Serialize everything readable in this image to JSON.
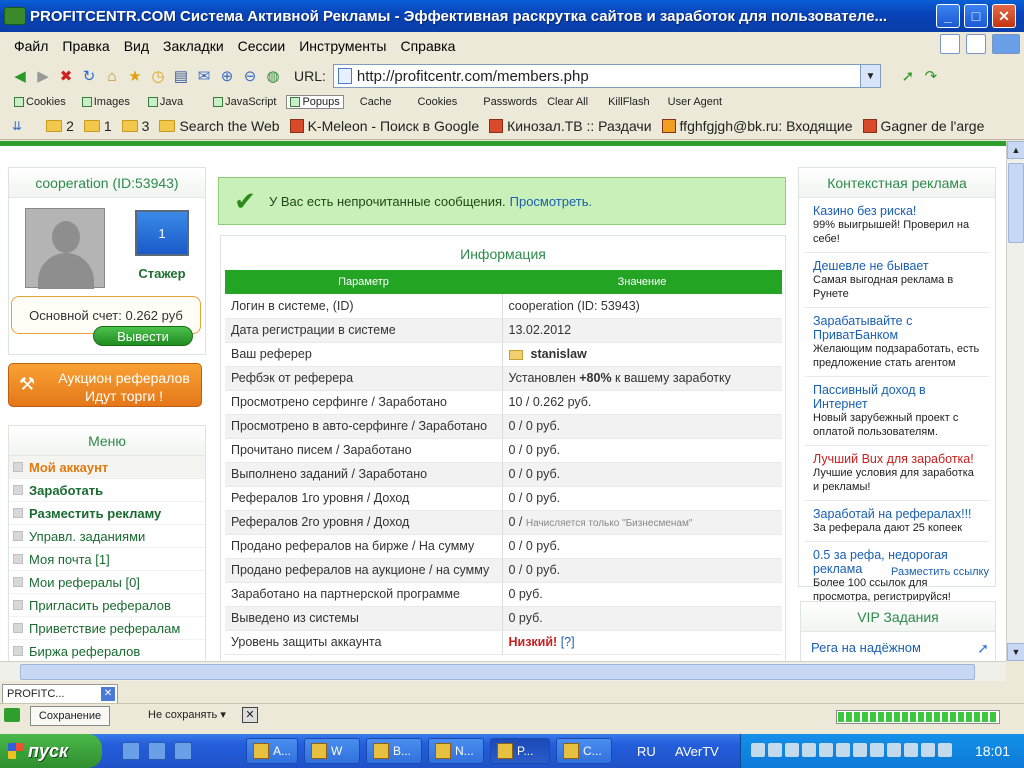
{
  "window": {
    "title": "PROFITCENTR.COM Система Активной Рекламы - Эффективная раскрутка сайтов и заработок для пользователе...",
    "min_symbol": "_",
    "max_symbol": "□",
    "close_symbol": "✕"
  },
  "menubar": [
    "Файл",
    "Правка",
    "Вид",
    "Закладки",
    "Сессии",
    "Инструменты",
    "Справка"
  ],
  "nav": {
    "url_label": "URL:",
    "url": "http://profitcentr.com/members.php"
  },
  "plugins": [
    "Cookies",
    "Images",
    "Java",
    "JavaScript",
    "Popups",
    "Cache",
    "Cookies",
    "Passwords",
    "Clear All",
    "KillFlash",
    "User Agent"
  ],
  "bookmarks": [
    "2",
    "1",
    "3",
    "Search the Web",
    "K-Meleon - Поиск в Google",
    "Кинозал.ТВ :: Раздачи",
    "ffghfgjgh@bk.ru: Входящие",
    "Gagner de l'arge"
  ],
  "user": {
    "name": "cooperation (ID:53943)",
    "level_number": "1",
    "rank": "Стажер",
    "balance": "Основной счет: 0.262 руб",
    "withdraw": "Вывести"
  },
  "auction": {
    "line1": "Аукцион рефералов",
    "line2": "Идут торги !"
  },
  "menu": {
    "title": "Меню",
    "items": [
      {
        "label": "Мой аккаунт",
        "style": "active"
      },
      {
        "label": "Заработать",
        "style": "bold"
      },
      {
        "label": "Разместить рекламу",
        "style": "bold"
      },
      {
        "label": "Управл. заданиями",
        "style": ""
      },
      {
        "label": "Моя почта   [1]",
        "style": ""
      },
      {
        "label": "Мои рефералы [0]",
        "style": ""
      },
      {
        "label": "Пригласить рефералов",
        "style": ""
      },
      {
        "label": "Приветствие рефералам",
        "style": ""
      },
      {
        "label": "Биржа рефералов",
        "style": ""
      }
    ]
  },
  "notice": {
    "text": "У Вас есть непрочитанные сообщения.",
    "link": "Просмотреть."
  },
  "info": {
    "title": "Информация",
    "columns": [
      "Параметр",
      "Значение"
    ],
    "rows": [
      {
        "param": "Логин в системе, (ID)",
        "value": "cooperation (ID: 53943)"
      },
      {
        "param": "Дата регистрации в системе",
        "value": "13.02.2012"
      },
      {
        "param": "Ваш реферер",
        "value": "stanislaw"
      },
      {
        "param": "Рефбэк от реферера",
        "value_pre": "Установлен",
        "value_strong": "+80%",
        "value_post": "к вашему заработку"
      },
      {
        "param": "Просмотрено серфинге / Заработано",
        "value": "10 / 0.262 руб."
      },
      {
        "param": "Просмотрено в авто-серфинге / Заработано",
        "value": "0 / 0 руб."
      },
      {
        "param": "Прочитано писем / Заработано",
        "value": "0 / 0 руб."
      },
      {
        "param": "Выполнено заданий / Заработано",
        "value": "0 / 0 руб."
      },
      {
        "param": "Рефералов 1го уровня / Доход",
        "value": "0 / 0 руб."
      },
      {
        "param": "Рефералов 2го уровня / Доход",
        "value": "0 /",
        "value_note": "Начисляется только \"Бизнесменам\""
      },
      {
        "param": "Продано рефералов на бирже / На сумму",
        "value": "0 / 0 руб."
      },
      {
        "param": "Продано рефералов на аукционе / на сумму",
        "value": "0 / 0 руб."
      },
      {
        "param": "Заработано на партнерской программе",
        "value": "0 руб."
      },
      {
        "param": "Выведено из системы",
        "value": "0 руб."
      },
      {
        "param": "Уровень защиты аккаунта",
        "value_warn": "Низкий!",
        "value_link": "[?]"
      }
    ]
  },
  "ads": {
    "title": "Контекстная реклама",
    "items": [
      {
        "title": "Казино без риска!",
        "desc": "99% выигрышей! Проверил на себе!",
        "red": false
      },
      {
        "title": "Дешевле не бывает",
        "desc": "Самая выгодная реклама в Рунете",
        "red": false
      },
      {
        "title": "Зарабатывайте с ПриватБанком",
        "desc": "Желающим подзаработать, есть предложение стать агентом",
        "red": false
      },
      {
        "title": "Пассивный доход в Интернет",
        "desc": "Новый зарубежный проект с оплатой пользователям.",
        "red": false
      },
      {
        "title": "Лучший Bux для заработка!",
        "desc": "Лучшие условия для заработка и рекламы!",
        "red": true
      },
      {
        "title": "Заработай на рефералах!!!",
        "desc": "За реферала дают 25 копеек",
        "red": false
      },
      {
        "title": "0.5 за рефа, недорогая реклама",
        "desc": "Более 100 ссылок для просмотра, регистрируйся!",
        "red": false
      }
    ],
    "footer": "Разместить ссылку"
  },
  "vip": {
    "title": "VIP Задания",
    "item": "Рега на надёжном"
  },
  "tab": {
    "label": "PROFITC...",
    "close_symbol": "✕"
  },
  "status": {
    "save": "Сохранение",
    "nosave": "Не сохранять",
    "x": "✕",
    "progress": 1.0
  },
  "taskbar": {
    "start": "пуск",
    "tasks": [
      "A...",
      "W",
      "B...",
      "N...",
      "P...",
      "C..."
    ],
    "lang": "RU",
    "aver": "AVerTV",
    "clock": "18:01"
  }
}
